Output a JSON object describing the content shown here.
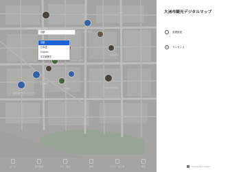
{
  "app": {
    "title": "大洲市観光デジタルマップ"
  },
  "map": {
    "labels": [
      "大洲市観光協会 · 足湯",
      "大洲まちの駅 浪漫",
      "臥龍山荘",
      "おはなはん通り",
      "大洲神社",
      "大洲城",
      "大洲市立博物館",
      "ほのぼの ポケットパーク"
    ]
  },
  "bottom_nav": {
    "items": [
      {
        "label": "ホーム",
        "icon": "home-icon"
      },
      {
        "label": "観光情報",
        "icon": "info-icon"
      },
      {
        "label": "見る・遊ぶ",
        "icon": "sightseeing-icon"
      },
      {
        "label": "体験",
        "icon": "experience-icon"
      },
      {
        "label": "グルメ・お土産",
        "icon": "food-icon"
      },
      {
        "label": "宿泊",
        "icon": "hotel-icon"
      }
    ]
  },
  "settings": {
    "language": {
      "label": "言語設定",
      "icon": "globe-icon",
      "selected": "自動"
    },
    "license": {
      "label": "ライセンス",
      "icon": "copyright-icon"
    }
  },
  "dropdown": {
    "options": [
      "自動",
      "日本語",
      "English",
      "中文繁體字"
    ],
    "highlighted_index": 0
  },
  "footer": {
    "text": "Powered by mapgo"
  },
  "colors": {
    "highlight": "#1e63d6",
    "map_bg": "#b9b9b6"
  }
}
